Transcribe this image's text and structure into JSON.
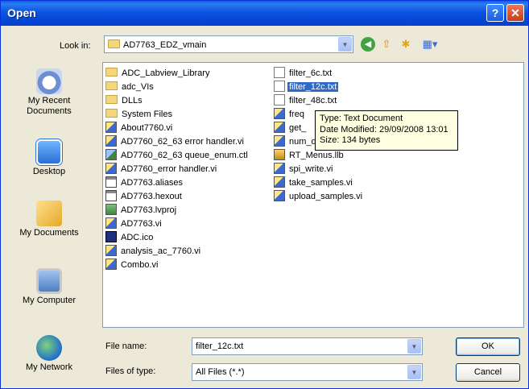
{
  "window": {
    "title": "Open"
  },
  "lookin": {
    "label": "Look in:",
    "value": "AD7763_EDZ_vmain"
  },
  "places": [
    {
      "label": "My Recent Documents",
      "icon": "recent-documents-icon"
    },
    {
      "label": "Desktop",
      "icon": "desktop-icon"
    },
    {
      "label": "My Documents",
      "icon": "my-documents-icon"
    },
    {
      "label": "My Computer",
      "icon": "my-computer-icon"
    },
    {
      "label": "My Network",
      "icon": "my-network-icon"
    }
  ],
  "files_col1": [
    {
      "name": "ADC_Labview_Library",
      "type": "folder"
    },
    {
      "name": "adc_VIs",
      "type": "folder"
    },
    {
      "name": "DLLs",
      "type": "folder"
    },
    {
      "name": "System Files",
      "type": "folder"
    },
    {
      "name": "About7760.vi",
      "type": "vi"
    },
    {
      "name": "AD7760_62_63 error handler.vi",
      "type": "vi"
    },
    {
      "name": "AD7760_62_63 queue_enum.ctl",
      "type": "ctl"
    },
    {
      "name": "AD7760_error handler.vi",
      "type": "vi"
    },
    {
      "name": "AD7763.aliases",
      "type": "generic"
    },
    {
      "name": "AD7763.hexout",
      "type": "generic"
    },
    {
      "name": "AD7763.lvproj",
      "type": "proj"
    },
    {
      "name": "AD7763.vi",
      "type": "vi"
    },
    {
      "name": "ADC.ico",
      "type": "ico"
    },
    {
      "name": "analysis_ac_7760.vi",
      "type": "vi"
    },
    {
      "name": "Combo.vi",
      "type": "vi"
    }
  ],
  "files_col2": [
    {
      "name": "filter_6c.txt",
      "type": "txt"
    },
    {
      "name": "filter_12c.txt",
      "type": "txt",
      "selected": true
    },
    {
      "name": "filter_48c.txt",
      "type": "txt"
    },
    {
      "name": "freq",
      "type": "vi"
    },
    {
      "name": "get_",
      "type": "vi"
    },
    {
      "name": "num_devices.vi",
      "type": "vi"
    },
    {
      "name": "RT_Menus.llb",
      "type": "llb"
    },
    {
      "name": "spi_write.vi",
      "type": "vi"
    },
    {
      "name": "take_samples.vi",
      "type": "vi"
    },
    {
      "name": "upload_samples.vi",
      "type": "vi"
    }
  ],
  "tooltip": {
    "type": "Type: Text Document",
    "modified": "Date Modified: 29/09/2008 13:01",
    "size": "Size: 134 bytes"
  },
  "filename": {
    "label": "File name:",
    "value": "filter_12c.txt"
  },
  "filetype": {
    "label": "Files of type:",
    "value": "All Files (*.*)"
  },
  "buttons": {
    "ok": "OK",
    "cancel": "Cancel"
  },
  "toolbar_icons": [
    "back-icon",
    "up-folder-icon",
    "new-folder-icon",
    "views-menu-icon"
  ]
}
